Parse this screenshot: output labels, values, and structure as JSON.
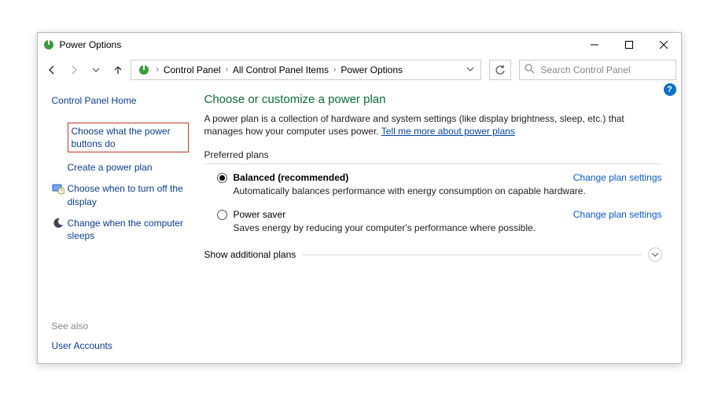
{
  "titlebar": {
    "title": "Power Options"
  },
  "breadcrumb": {
    "items": [
      "Control Panel",
      "All Control Panel Items",
      "Power Options"
    ]
  },
  "search": {
    "placeholder": "Search Control Panel"
  },
  "sidebar": {
    "home": "Control Panel Home",
    "links": [
      {
        "label": "Choose what the power buttons do",
        "highlighted": true
      },
      {
        "label": "Create a power plan"
      },
      {
        "label": "Choose when to turn off the display",
        "icon": "display-timer-icon"
      },
      {
        "label": "Change when the computer sleeps",
        "icon": "moon-icon"
      }
    ],
    "seealso_label": "See also",
    "seealso_links": [
      "User Accounts"
    ]
  },
  "main": {
    "heading": "Choose or customize a power plan",
    "description": "A power plan is a collection of hardware and system settings (like display brightness, sleep, etc.) that manages how your computer uses power. ",
    "desc_link": "Tell me more about power plans",
    "preferred_label": "Preferred plans",
    "plans": [
      {
        "name": "Balanced (recommended)",
        "desc": "Automatically balances performance with energy consumption on capable hardware.",
        "selected": true,
        "change": "Change plan settings"
      },
      {
        "name": "Power saver",
        "desc": "Saves energy by reducing your computer's performance where possible.",
        "selected": false,
        "change": "Change plan settings"
      }
    ],
    "show_additional": "Show additional plans"
  }
}
